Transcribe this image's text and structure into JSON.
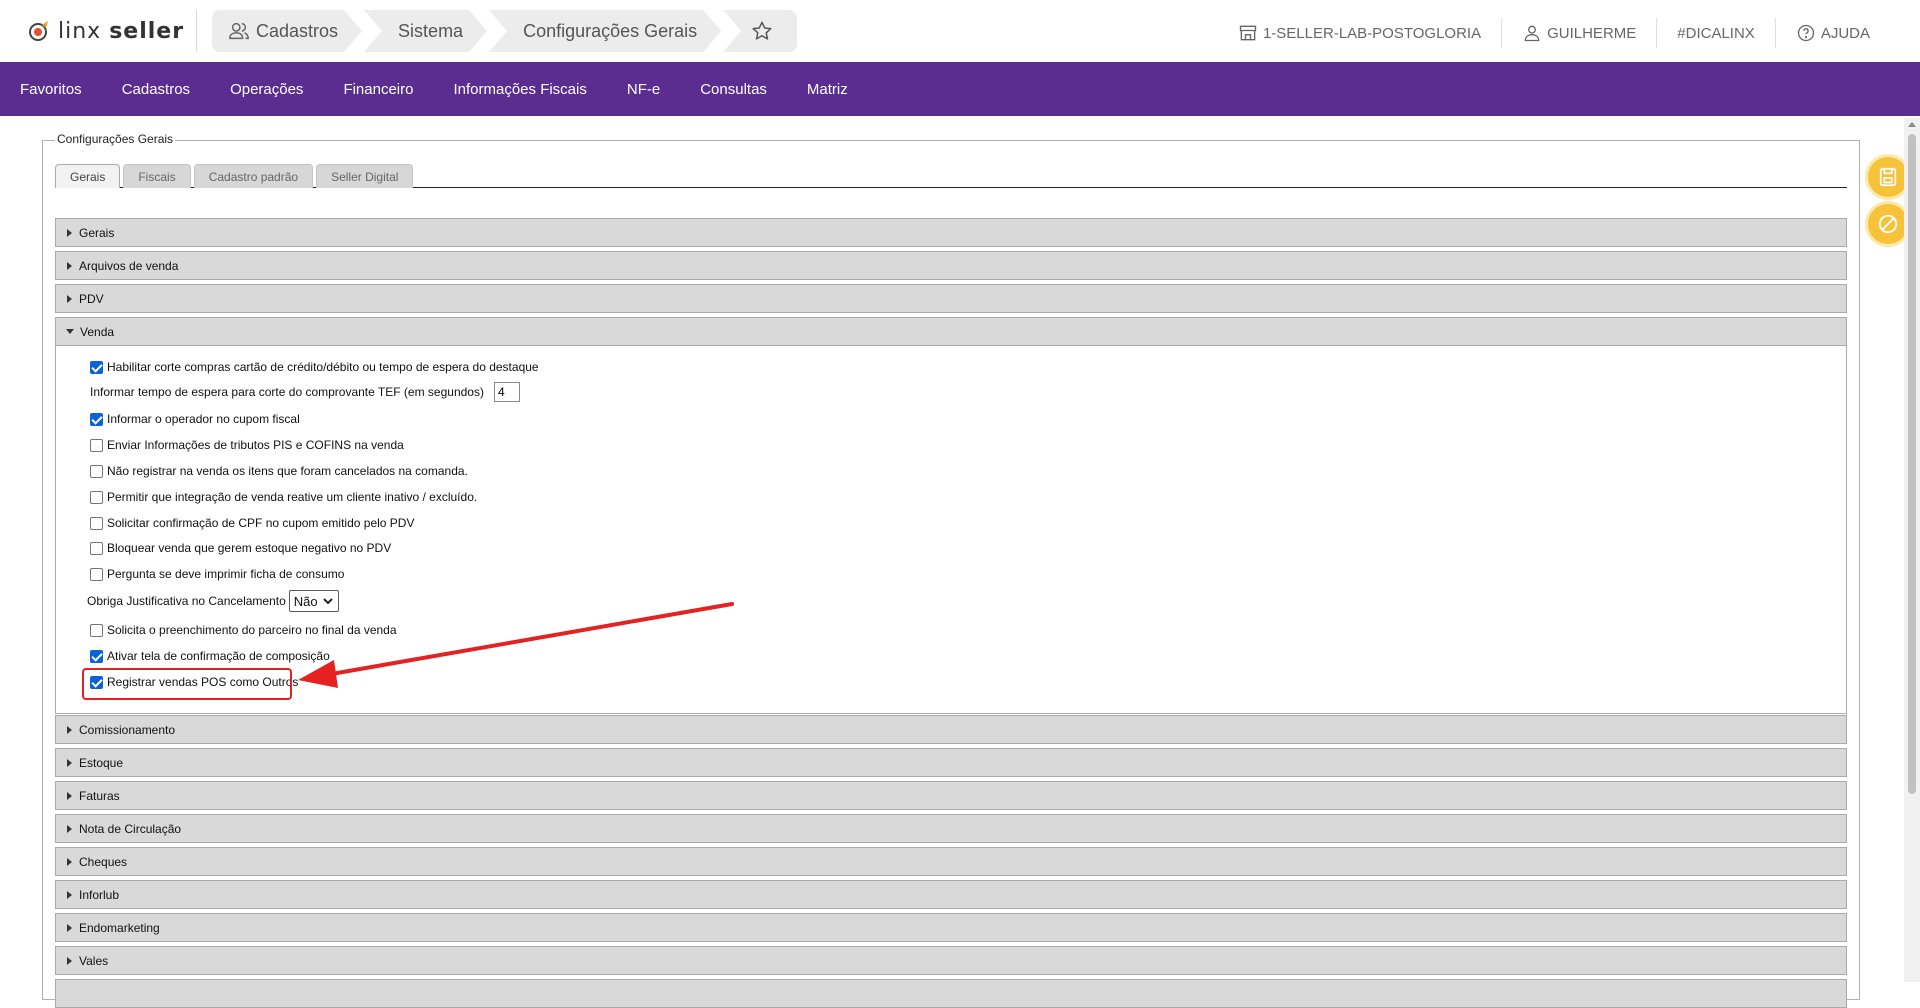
{
  "header": {
    "logo_text_light": "linx",
    "logo_text_bold": "seller",
    "breadcrumb": [
      "Cadastros",
      "Sistema",
      "Configurações Gerais"
    ],
    "store": "1-SELLER-LAB-POSTOGLORIA",
    "user": "GUILHERME",
    "hashtag": "#DICALINX",
    "help": "AJUDA"
  },
  "nav": [
    "Favoritos",
    "Cadastros",
    "Operações",
    "Financeiro",
    "Informações Fiscais",
    "NF-e",
    "Consultas",
    "Matriz"
  ],
  "fieldset_legend": "Configurações Gerais",
  "tabs": [
    "Gerais",
    "Fiscais",
    "Cadastro padrão",
    "Seller Digital"
  ],
  "sections_before": [
    "Gerais",
    "Arquivos de venda",
    "PDV"
  ],
  "open_section": "Venda",
  "venda_options": {
    "opt1": "Habilitar corte compras cartão de crédito/débito ou tempo de espera do destaque",
    "tef_label": "Informar tempo de espera para corte do comprovante TEF (em segundos)",
    "tef_value": "4",
    "opt2": "Informar o operador no cupom fiscal",
    "opt3": "Enviar Informações de tributos PIS e COFINS na venda",
    "opt4": "Não registrar na venda os itens que foram cancelados na comanda.",
    "opt5": "Permitir que integração de venda reative um cliente inativo / excluído.",
    "opt6": "Solicitar confirmação de CPF no cupom emitido pelo PDV",
    "opt7": "Bloquear venda que gerem estoque negativo no PDV",
    "opt8": "Pergunta se deve imprimir ficha de consumo",
    "just_label": "Obriga Justificativa no Cancelamento",
    "just_value": "Não",
    "opt9": "Solicita o preenchimento do parceiro no final da venda",
    "opt10": "Ativar tela de confirmação de composição",
    "opt11": "Registrar vendas POS como Outros"
  },
  "sections_after": [
    "Comissionamento",
    "Estoque",
    "Faturas",
    "Nota de Circulação",
    "Cheques",
    "Inforlub",
    "Endomarketing",
    "Vales"
  ],
  "colors": {
    "nav_bg": "#5b2d91",
    "accent_yellow": "#f5c23a",
    "annotation_red": "#e52222",
    "checkbox_blue": "#0a64d8"
  }
}
